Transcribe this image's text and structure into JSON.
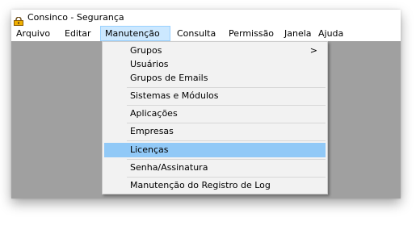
{
  "window": {
    "title": "Consinco - Segurança"
  },
  "menubar": {
    "items": [
      {
        "label": "Arquivo"
      },
      {
        "label": "Editar"
      },
      {
        "label": "Manutenção"
      },
      {
        "label": "Consulta"
      },
      {
        "label": "Permissão"
      },
      {
        "label": "Janela"
      },
      {
        "label": "Ajuda"
      }
    ],
    "active": "Manutenção"
  },
  "dropdown": {
    "items": [
      {
        "label": "Grupos",
        "submenu_arrow": ">"
      },
      {
        "label": "Usuários"
      },
      {
        "label": "Grupos de Emails"
      },
      {
        "label": "Sistemas e Módulos"
      },
      {
        "label": "Aplicações"
      },
      {
        "label": "Empresas"
      },
      {
        "label": "Licenças"
      },
      {
        "label": "Senha/Assinatura"
      },
      {
        "label": "Manutenção do Registro de Log"
      }
    ],
    "highlighted": "Licenças"
  },
  "colors": {
    "workspace": "#a0a0a0",
    "menu_active_bg": "#cce8ff",
    "item_highlight": "#91c9f7",
    "dropdown_bg": "#f2f2f2"
  },
  "icons": {
    "app": "lock-icon"
  }
}
